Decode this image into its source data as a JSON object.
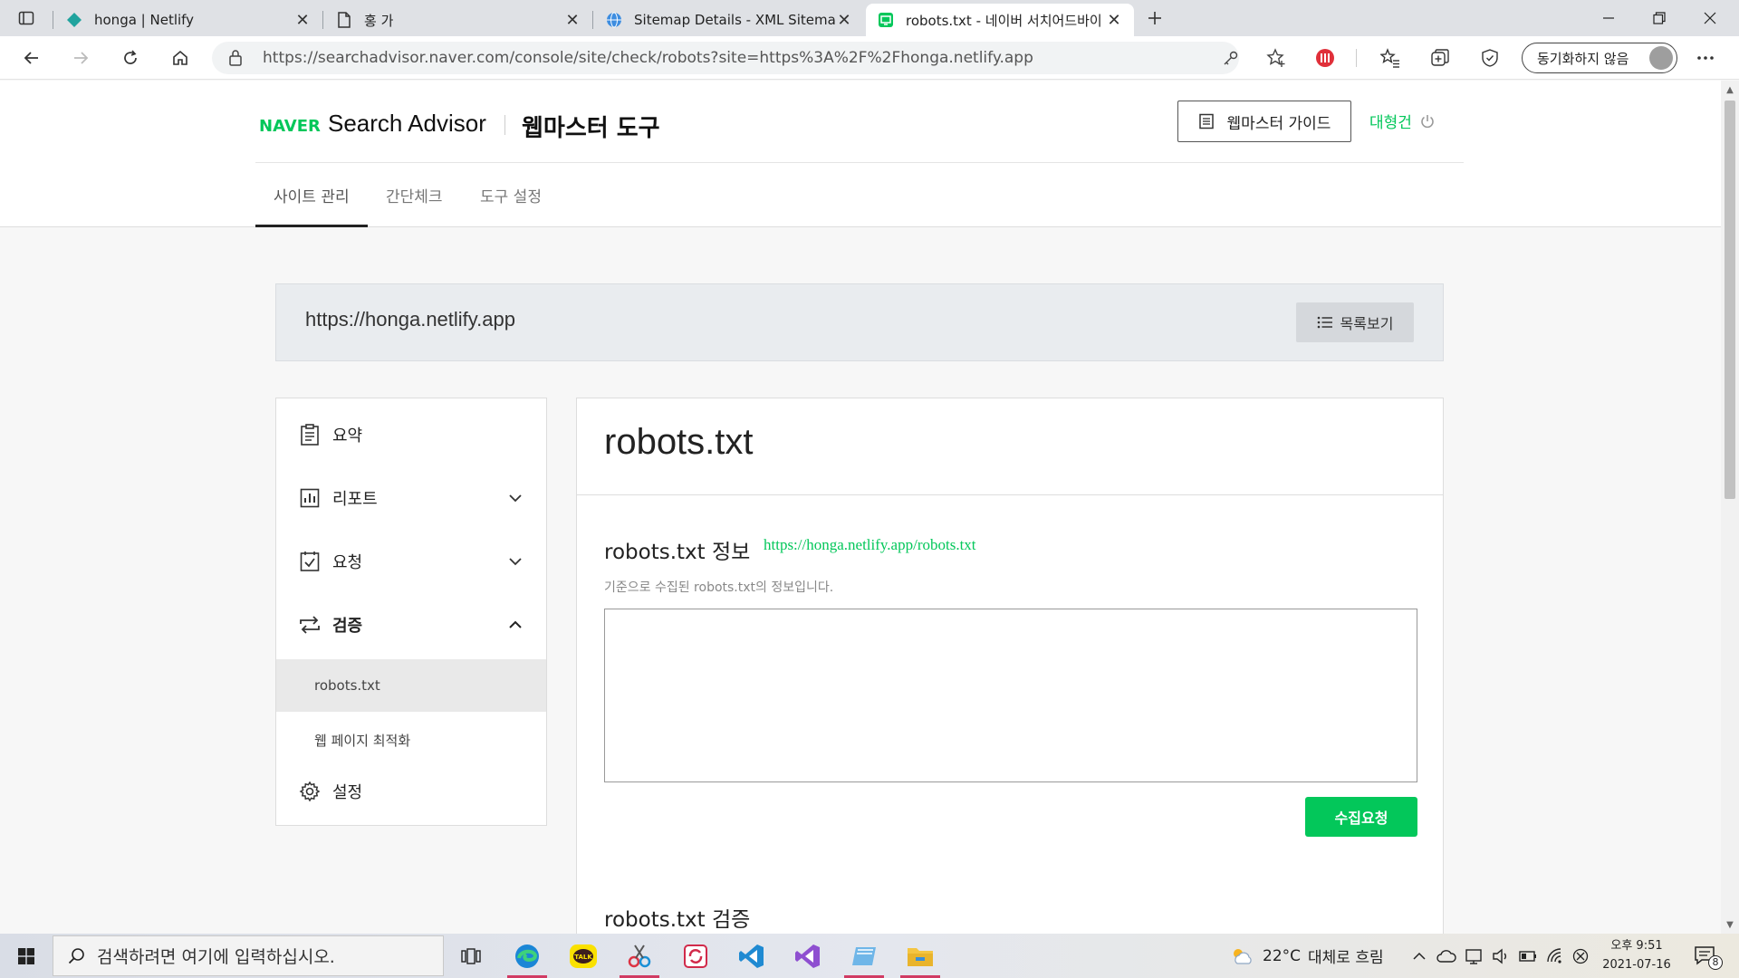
{
  "browser": {
    "tabs": [
      {
        "title": "honga | Netlify",
        "icon": "netlify-icon",
        "active": false
      },
      {
        "title": "홍 가",
        "icon": "page-icon",
        "active": false
      },
      {
        "title": "Sitemap Details - XML Sitemaps",
        "icon": "globe-icon",
        "active": false
      },
      {
        "title": "robots.txt - 네이버 서치어드바이",
        "icon": "search-advisor-icon",
        "active": true
      }
    ],
    "url": "https://searchadvisor.naver.com/console/site/check/robots?site=https%3A%2F%2Fhonga.netlify.app",
    "sync_label": "동기화하지 않음",
    "colors": {
      "accent": "#03c75a"
    }
  },
  "header": {
    "brand": "NAVER",
    "product": "Search Advisor",
    "tool": "웹마스터 도구",
    "guide_label": "웹마스터 가이드",
    "user": "대형건"
  },
  "nav": {
    "items": [
      {
        "label": "사이트 관리",
        "active": true
      },
      {
        "label": "간단체크",
        "active": false
      },
      {
        "label": "도구 설정",
        "active": false
      }
    ]
  },
  "site": {
    "url": "https://honga.netlify.app",
    "list_label": "목록보기"
  },
  "sidebar": {
    "items": [
      {
        "label": "요약",
        "icon": "clipboard-icon"
      },
      {
        "label": "리포트",
        "icon": "chart-icon",
        "expanded": false
      },
      {
        "label": "요청",
        "icon": "checkbox-icon",
        "expanded": false
      },
      {
        "label": "검증",
        "icon": "repeat-icon",
        "expanded": true
      },
      {
        "label": "설정",
        "icon": "gear-icon"
      }
    ],
    "sub_items": [
      {
        "label": "robots.txt",
        "active": true
      },
      {
        "label": "웹 페이지 최적화",
        "active": false
      }
    ]
  },
  "main": {
    "title": "robots.txt",
    "info_title": "robots.txt 정보",
    "info_link": "https://honga.netlify.app/robots.txt",
    "info_desc": "기준으로 수집된 robots.txt의 정보입니다.",
    "collect_label": "수집요청",
    "verify_title": "robots.txt 검증"
  },
  "taskbar": {
    "search_placeholder": "검색하려면 여기에 입력하십시오.",
    "weather_temp": "22°C",
    "weather_text": "대체로 흐림",
    "time": "오후 9:51",
    "date": "2021-07-16",
    "notification_count": "8"
  }
}
